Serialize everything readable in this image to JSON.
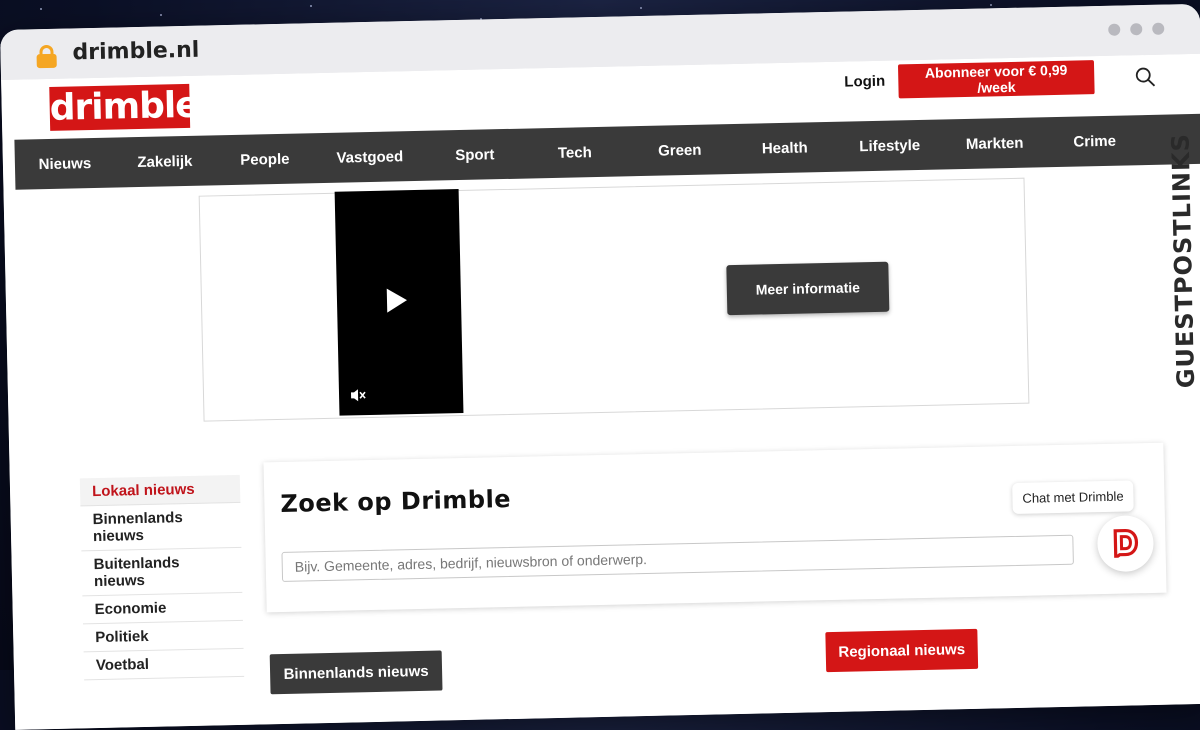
{
  "browser": {
    "url": "drimble.nl"
  },
  "header": {
    "logo": "drimble",
    "login": "Login",
    "subscribe": "Abonneer voor € 0,99 /week"
  },
  "nav": {
    "items": [
      "Nieuws",
      "Zakelijk",
      "People",
      "Vastgoed",
      "Sport",
      "Tech",
      "Green",
      "Health",
      "Lifestyle",
      "Markten",
      "Crime"
    ]
  },
  "ad": {
    "button": "Meer informatie"
  },
  "sidebar": {
    "items": [
      {
        "label": "Lokaal nieuws",
        "active": true
      },
      {
        "label": "Binnenlands nieuws",
        "active": false
      },
      {
        "label": "Buitenlands nieuws",
        "active": false
      },
      {
        "label": "Economie",
        "active": false
      },
      {
        "label": "Politiek",
        "active": false
      },
      {
        "label": "Voetbal",
        "active": false
      }
    ]
  },
  "search": {
    "title": "Zoek op Drimble",
    "placeholder": "Bijv. Gemeente, adres, bedrijf, nieuwsbron of onderwerp."
  },
  "chat": {
    "label": "Chat met Drimble"
  },
  "sections": {
    "binnenlands": "Binnenlands nieuws",
    "regionaal": "Regionaal nieuws"
  },
  "watermark": {
    "text": "GUESTPOSTLINKS"
  },
  "colors": {
    "brand_red": "#d41616",
    "nav_dark": "#3a3a3a",
    "active_red": "#c0141b"
  }
}
